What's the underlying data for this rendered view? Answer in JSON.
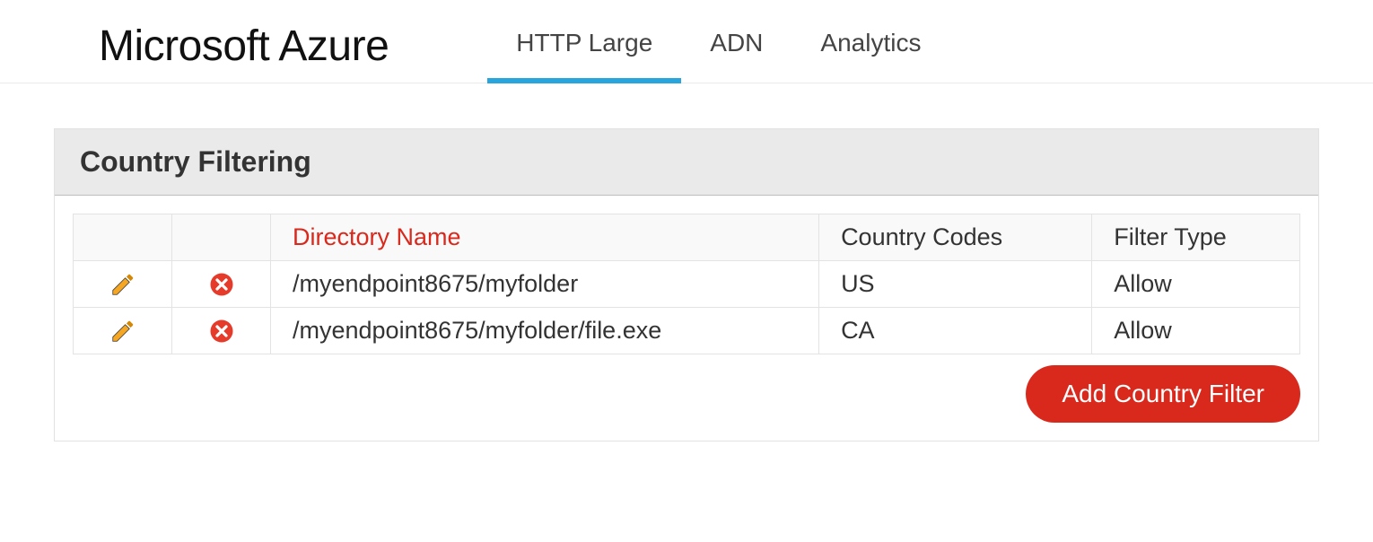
{
  "logo": "Microsoft Azure",
  "tabs": [
    {
      "label": "HTTP Large",
      "active": true
    },
    {
      "label": "ADN",
      "active": false
    },
    {
      "label": "Analytics",
      "active": false
    }
  ],
  "panel": {
    "title": "Country Filtering",
    "columns": {
      "directory_name": "Directory Name",
      "country_codes": "Country Codes",
      "filter_type": "Filter Type"
    },
    "rows": [
      {
        "directory_name": "/myendpoint8675/myfolder",
        "country_codes": "US",
        "filter_type": "Allow"
      },
      {
        "directory_name": "/myendpoint8675/myfolder/file.exe",
        "country_codes": "CA",
        "filter_type": "Allow"
      }
    ],
    "add_button": "Add Country Filter"
  }
}
